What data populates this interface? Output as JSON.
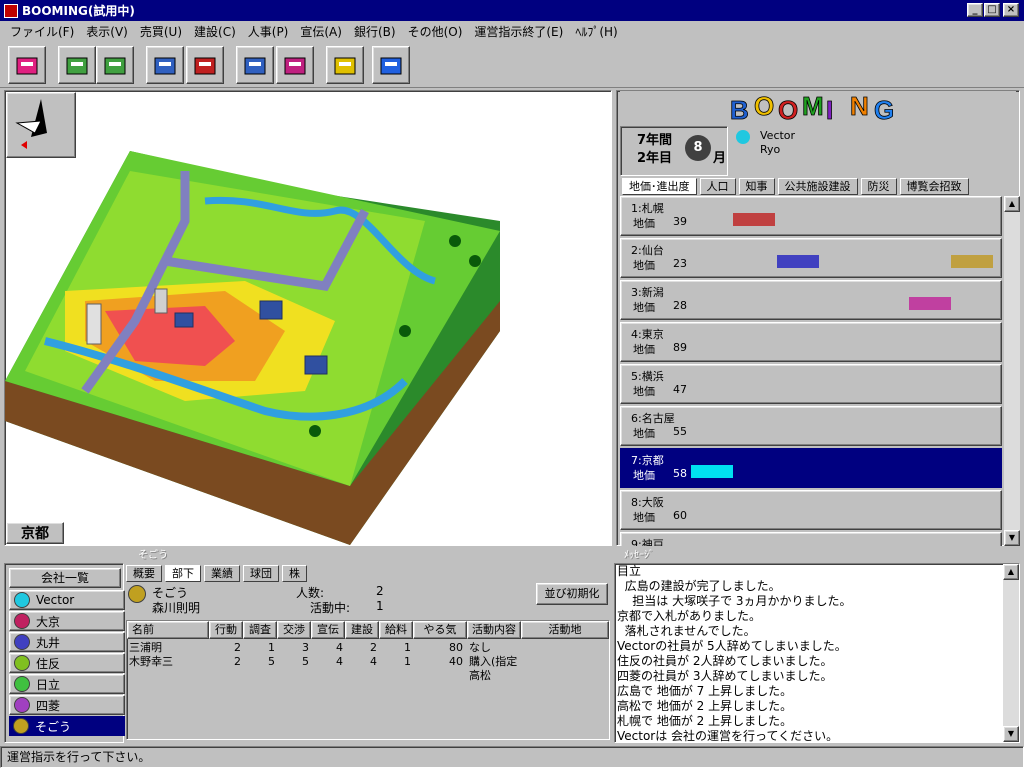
{
  "window": {
    "title": "BOOMING(試用中)"
  },
  "menu": [
    "ファイル(F)",
    "表示(V)",
    "売買(U)",
    "建設(C)",
    "人事(P)",
    "宣伝(A)",
    "銀行(B)",
    "その他(O)",
    "運営指示終了(E)",
    "ﾍﾙﾌﾟ(H)"
  ],
  "toolbar": [
    "land-icon",
    "sell-icon",
    "buy-icon",
    "build-icon",
    "hospital-icon",
    "staff-icon",
    "people-icon",
    "alert-icon",
    "go-icon"
  ],
  "map": {
    "city_label": "京都"
  },
  "logo": {
    "text": "BOOMING",
    "letter_colors": [
      "#2060d0",
      "#f0c000",
      "#d02020",
      "#20a020",
      "#8020c0",
      "#f08000",
      "#2080f0"
    ]
  },
  "date": {
    "line1": "7年間",
    "line2": "2年目",
    "month_num": "8",
    "month_unit": "月"
  },
  "player": {
    "company": "Vector",
    "name": "Ryo"
  },
  "tabs": [
    "地価･進出度",
    "人口",
    "知事",
    "公共施設建設",
    "防災",
    "博覧会招致"
  ],
  "cities": [
    {
      "name": "1:札幌",
      "label": "地価",
      "value": "39",
      "bars": [
        {
          "color": "#c04040",
          "fraction": 0.11
        }
      ]
    },
    {
      "name": "2:仙台",
      "label": "地価",
      "value": "23",
      "bars": [
        {
          "color": "#4040c0",
          "fraction": 0.11
        },
        {
          "color": "#c0a040",
          "fraction": 0.11
        }
      ]
    },
    {
      "name": "3:新潟",
      "label": "地価",
      "value": "28",
      "bars": [
        {
          "color": "#c040a0",
          "fraction": 0.11
        }
      ]
    },
    {
      "name": "4:東京",
      "label": "地価",
      "value": "89",
      "bars": []
    },
    {
      "name": "5:横浜",
      "label": "地価",
      "value": "47",
      "bars": []
    },
    {
      "name": "6:名古屋",
      "label": "地価",
      "value": "55",
      "bars": []
    },
    {
      "name": "7:京都",
      "label": "地価",
      "value": "58",
      "bars": [
        {
          "color": "#00e0f0",
          "fraction": 0.11
        }
      ],
      "selected": true
    },
    {
      "name": "8:大阪",
      "label": "地価",
      "value": "60",
      "bars": []
    },
    {
      "name": "9:神戸",
      "label": "",
      "value": "",
      "bars": []
    }
  ],
  "section_labels": {
    "left": "そごう",
    "right": "ﾒｯｾｰｼﾞ"
  },
  "companies_header": "会社一覧",
  "companies": [
    {
      "name": "Vector",
      "color": "#20c8e0"
    },
    {
      "name": "大京",
      "color": "#c02060"
    },
    {
      "name": "丸井",
      "color": "#4040c0"
    },
    {
      "name": "住反",
      "color": "#80c020"
    },
    {
      "name": "日立",
      "color": "#40c040"
    },
    {
      "name": "四菱",
      "color": "#a040c0"
    },
    {
      "name": "そごう",
      "color": "#c0a020",
      "selected": true
    }
  ],
  "detail": {
    "tabs": [
      "概要",
      "部下",
      "業績",
      "球団",
      "株"
    ],
    "active_tab": "部下",
    "company": "そごう",
    "manager": "森川則明",
    "people_label": "人数:",
    "people_value": "2",
    "active_label": "活動中:",
    "active_value": "1",
    "sort_button": "並び初期化",
    "columns": [
      "名前",
      "行動",
      "調査",
      "交渉",
      "宣伝",
      "建設",
      "給料",
      "やる気",
      "活動内容",
      "活動地"
    ],
    "rows": [
      {
        "name": "三浦明",
        "c1": "2",
        "c2": "1",
        "c3": "3",
        "c4": "4",
        "c5": "2",
        "c6": "1",
        "c7": "80",
        "act": "なし",
        "place": ""
      },
      {
        "name": "木野幸三",
        "c1": "2",
        "c2": "5",
        "c3": "5",
        "c4": "4",
        "c5": "4",
        "c6": "1",
        "c7": "40",
        "act": "購入(指定高松",
        "place": ""
      }
    ]
  },
  "messages": "目立\n  広島の建設が完了しました。\n    担当は 大塚咲子で 3ヵ月かかりました。\n京都で入札がありました。\n  落札されませんでした。\nVectorの社員が 5人辞めてしまいました。\n住反の社員が 2人辞めてしまいました。\n四菱の社員が 3人辞めてしまいました。\n広島で 地価が 7 上昇しました。\n高松で 地価が 2 上昇しました。\n札幌で 地価が 2 上昇しました。\nVectorは 会社の運営を行ってください。",
  "status": "運営指示を行って下さい。"
}
